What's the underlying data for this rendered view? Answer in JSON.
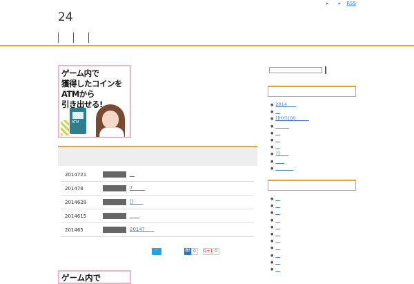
{
  "topnav": {
    "items": [
      "",
      "RSS"
    ]
  },
  "site": {
    "title": "24"
  },
  "gnav": {
    "items": [
      "",
      "",
      ""
    ]
  },
  "banner": {
    "lines": [
      "ゲーム内で",
      "獲得したコインを",
      "ATMから",
      "引き出せる!"
    ],
    "atm_label": "ATM"
  },
  "posts": [
    {
      "date": "2014721",
      "title": "__"
    },
    {
      "date": "201478",
      "title": "7_____"
    },
    {
      "date": "2014628",
      "title": "[]____"
    },
    {
      "date": "2014615",
      "title": "____"
    },
    {
      "date": "201465",
      "title": "2014?____"
    }
  ],
  "share": {
    "twitter_label": "🐦",
    "hatena_label": "B!",
    "hatena_count": "0",
    "gplus_label": "G+1",
    "gplus_count": "0"
  },
  "banner2": {
    "text": "ゲーム内で"
  },
  "search": {
    "value": "",
    "placeholder": ""
  },
  "widget1": {
    "heading": "",
    "items": [
      "2014____",
      "__",
      "[]HY]100______",
      "______",
      "__",
      "__",
      "__",
      "?]____",
      "____",
      "________"
    ]
  },
  "widget2": {
    "heading": "",
    "items": [
      "__",
      "__",
      "__",
      "__",
      "__",
      "__",
      "__",
      "__",
      "__",
      "__",
      "__"
    ]
  },
  "colors": {
    "accent": "#f0a030",
    "link": "#3b7dc4",
    "banner_border": "#f3b2c6"
  }
}
